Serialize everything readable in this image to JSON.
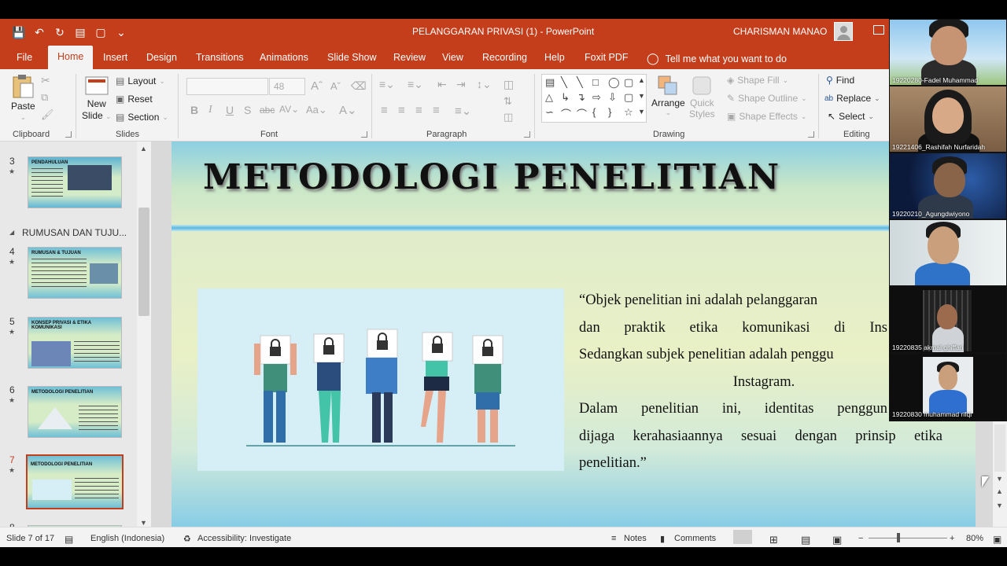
{
  "window": {
    "doc_title": "PELANGGARAN PRIVASI (1)  -  PowerPoint",
    "user_name": "CHARISMAN MANAO"
  },
  "tabs": [
    "File",
    "Home",
    "Insert",
    "Design",
    "Transitions",
    "Animations",
    "Slide Show",
    "Review",
    "View",
    "Recording",
    "Help",
    "Foxit PDF"
  ],
  "active_tab": "Home",
  "tell_me": "Tell me what you want to do",
  "ribbon": {
    "clipboard": {
      "label": "Clipboard",
      "paste": "Paste"
    },
    "slides": {
      "label": "Slides",
      "new_slide_1": "New",
      "new_slide_2": "Slide",
      "layout": "Layout",
      "reset": "Reset",
      "section": "Section"
    },
    "font": {
      "label": "Font",
      "size": "48"
    },
    "paragraph": {
      "label": "Paragraph"
    },
    "drawing": {
      "label": "Drawing",
      "arrange": "Arrange",
      "quick_styles_1": "Quick",
      "quick_styles_2": "Styles",
      "shape_fill": "Shape Fill",
      "shape_outline": "Shape Outline",
      "shape_effects": "Shape Effects"
    },
    "editing": {
      "label": "Editing",
      "find": "Find",
      "replace": "Replace",
      "select": "Select"
    }
  },
  "thumbnails": [
    {
      "num": "3",
      "title": "PENDAHULUAN"
    },
    {
      "num": "4",
      "title": "RUMUSAN & TUJUAN"
    },
    {
      "num": "5",
      "title": "KONSEP PRIVASI & ETIKA KOMUNIKASI"
    },
    {
      "num": "6",
      "title": "METODOLOGI PENELITIAN"
    },
    {
      "num": "7",
      "title": "METODOLOGI PENELITIAN"
    },
    {
      "num": "8",
      "title": ""
    }
  ],
  "section_label": "RUMUSAN DAN TUJU...",
  "slide": {
    "title": "METODOLOGI PENELITIAN",
    "paragraphs": [
      "“Objek penelitian ini adalah pelanggaran",
      "dan praktik etika komunikasi di Ins",
      "Sedangkan subjek penelitian adalah penggu",
      "Instagram.",
      "Dalam penelitian ini, identitas penggun",
      "dijaga kerahasiaannya sesuai dengan prinsip etika",
      "penelitian.”"
    ]
  },
  "status": {
    "slide_info": "Slide 7 of 17",
    "language": "English (Indonesia)",
    "accessibility": "Accessibility: Investigate",
    "notes": "Notes",
    "comments": "Comments",
    "zoom": "80%"
  },
  "participants": [
    "19220280-Fadel Muhammad",
    "19221406_Rashifah Nurfaridah",
    "19220210_Agungdwiyono",
    "",
    "19220835 akmal ghiffari",
    "19220830 muhammad rifqi"
  ],
  "colors": {
    "accent": "#c43e1c"
  }
}
